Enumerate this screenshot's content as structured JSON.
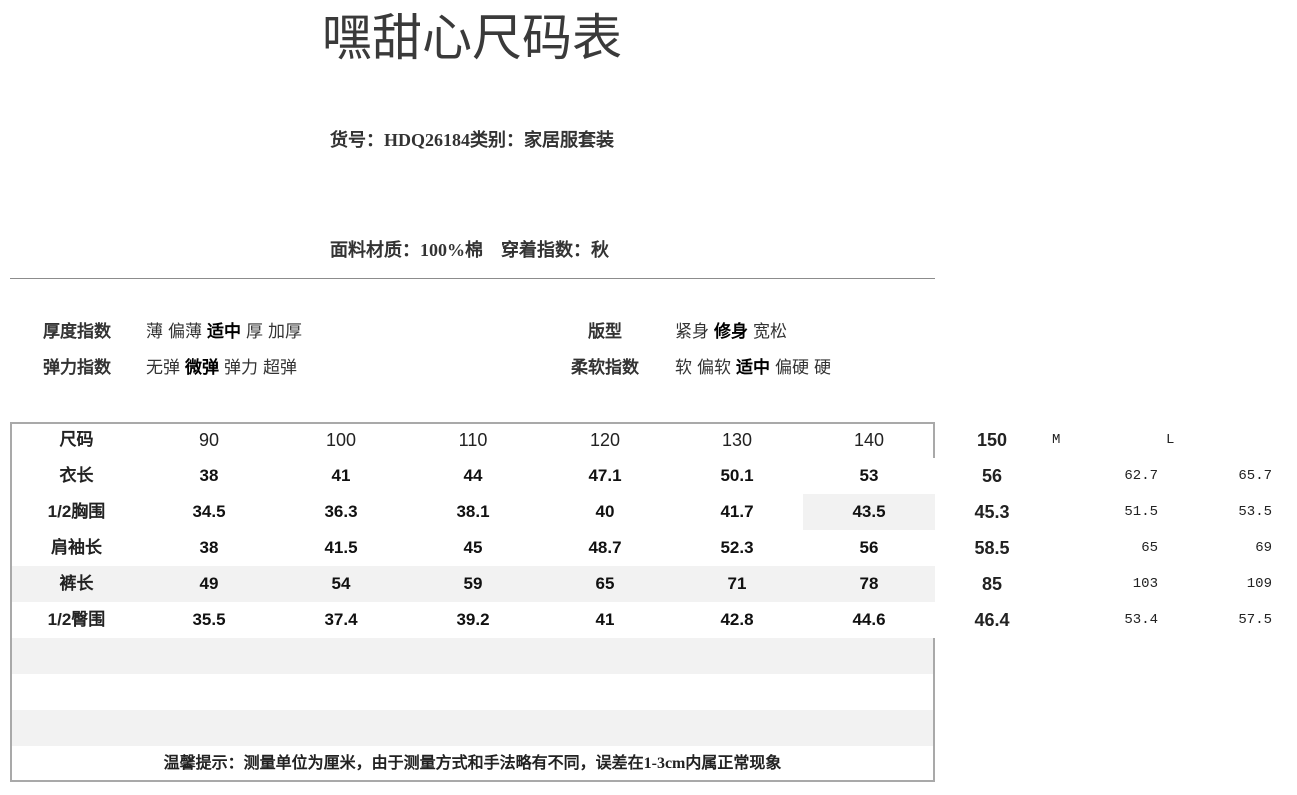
{
  "title": "嘿甜心尺码表",
  "info": {
    "product_line": "货号：HDQ26184类别：家居服套装",
    "fabric_line": "面料材质：100%棉　穿着指数：秋"
  },
  "attributes": {
    "thickness": {
      "label": "厚度指数",
      "options": [
        {
          "text": "薄"
        },
        {
          "text": "偏薄"
        },
        {
          "text": "适中",
          "selected": true
        },
        {
          "text": "厚"
        },
        {
          "text": "加厚"
        }
      ]
    },
    "fit": {
      "label": "版型",
      "options": [
        {
          "text": "紧身"
        },
        {
          "text": "修身",
          "selected": true
        },
        {
          "text": "宽松"
        }
      ]
    },
    "elasticity": {
      "label": "弹力指数",
      "options": [
        {
          "text": "无弹"
        },
        {
          "text": "微弹",
          "selected": true
        },
        {
          "text": "弹力"
        },
        {
          "text": "超弹"
        }
      ]
    },
    "softness": {
      "label": "柔软指数",
      "options": [
        {
          "text": "软"
        },
        {
          "text": "偏软"
        },
        {
          "text": "适中",
          "selected": true
        },
        {
          "text": "偏硬"
        },
        {
          "text": "硬"
        }
      ]
    }
  },
  "size_table": {
    "header_label": "尺码",
    "sizes": [
      "90",
      "100",
      "110",
      "120",
      "130",
      "140",
      "150",
      "M",
      "L"
    ],
    "rows": [
      {
        "label": "衣长",
        "values": [
          "38",
          "41",
          "44",
          "47.1",
          "50.1",
          "53",
          "56",
          "62.7",
          "65.7"
        ]
      },
      {
        "label": "1/2胸围",
        "values": [
          "34.5",
          "36.3",
          "38.1",
          "40",
          "41.7",
          "43.5",
          "45.3",
          "51.5",
          "53.5"
        ]
      },
      {
        "label": "肩袖长",
        "values": [
          "38",
          "41.5",
          "45",
          "48.7",
          "52.3",
          "56",
          "58.5",
          "65",
          "69"
        ]
      },
      {
        "label": "裤长",
        "values": [
          "49",
          "54",
          "59",
          "65",
          "71",
          "78",
          "85",
          "103",
          "109"
        ]
      },
      {
        "label": "1/2臀围",
        "values": [
          "35.5",
          "37.4",
          "39.2",
          "41",
          "42.8",
          "44.6",
          "46.4",
          "53.4",
          "57.5"
        ]
      }
    ],
    "footer_note": "温馨提示：测量单位为厘米，由于测量方式和手法略有不同，误差在1-3cm内属正常现象"
  },
  "colors": {
    "text": "#222222",
    "shaded_fill": "#f2f2f2",
    "table_border": "#a9a9a9",
    "divider": "#8c8c8c"
  }
}
